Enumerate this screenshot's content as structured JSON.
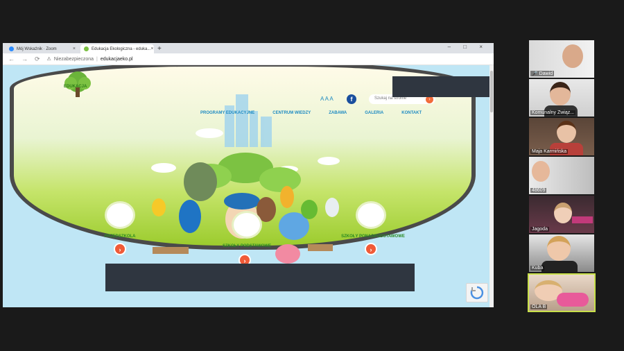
{
  "browser": {
    "tabs": [
      {
        "label": "Mój Wskaźnik · Zoom",
        "active": false,
        "icon": "zoom-icon"
      },
      {
        "label": "Edukacja Ekologiczna - eduka...",
        "active": true,
        "icon": "site-icon"
      }
    ],
    "new_tab": "+",
    "window_controls": "– □ ×",
    "address": {
      "security_label": "Niezabezpieczona",
      "domain": "edukacjaeko.pl"
    }
  },
  "website": {
    "logo_text": "EDUKACJA",
    "font_size_control": "A A A",
    "facebook_label": "f",
    "search_placeholder": "Szukaj na stronie",
    "search_button": "›",
    "menu": [
      "PROGRAMY EDUKACYJNE",
      "CENTRUM WIEDZY",
      "ZABAWA",
      "GALERIA",
      "KONTAKT"
    ],
    "categories": [
      {
        "label": "PRZEDSZKOLA",
        "button": "›"
      },
      {
        "label": "SZKOŁY PODSTAWOWE",
        "button": "›"
      },
      {
        "label": "SZKOŁY PONADPODSTAWOWE",
        "button": "›"
      }
    ]
  },
  "participants": [
    {
      "name": "Dawid",
      "muted": true
    },
    {
      "name": "Komunalny Związ...",
      "muted": false
    },
    {
      "name": "Maja Karmińska",
      "muted": false
    },
    {
      "name": "48609",
      "muted": false
    },
    {
      "name": "Jagoda",
      "muted": false
    },
    {
      "name": "Kuba",
      "muted": false
    },
    {
      "name": "OLA B",
      "muted": false,
      "active_speaker": true
    }
  ],
  "colors": {
    "accent_orange": "#f05a37",
    "menu_blue": "#1d8ac2",
    "active_speaker_border": "#c8e04a",
    "redaction": "#2f3640"
  }
}
